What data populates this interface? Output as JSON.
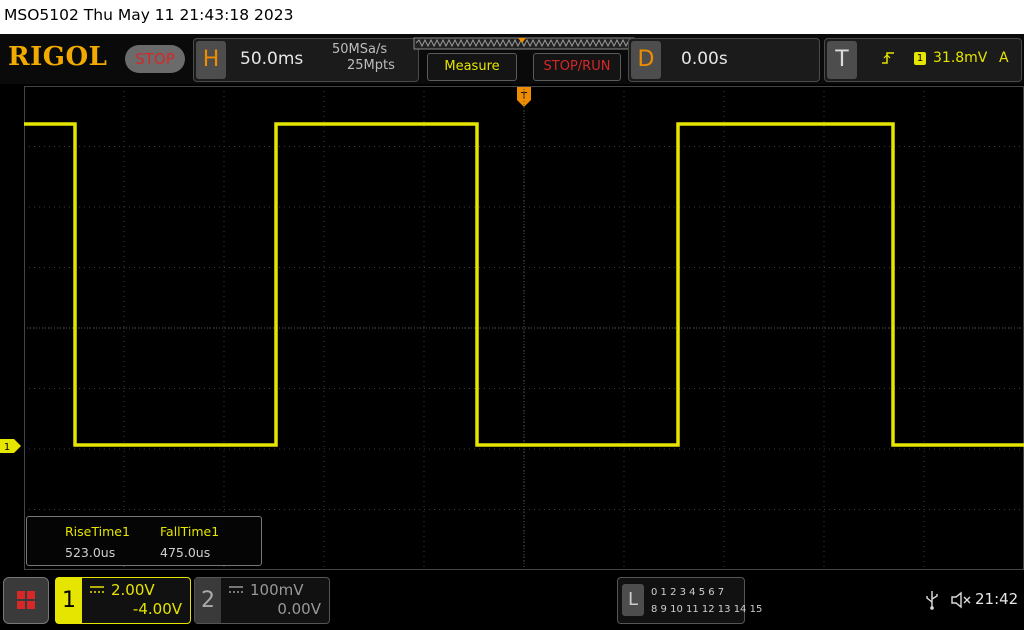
{
  "window": {
    "title": "MSO5102  Thu May 11 21:43:18 2023"
  },
  "header": {
    "logo": "RIGOL",
    "run_state": "STOP",
    "horizontal": {
      "letter": "H",
      "timebase": "50.0ms",
      "sample_rate": "50MSa/s",
      "memory_depth": "25Mpts"
    },
    "measure_label": "Measure",
    "stop_run_label": "STOP/RUN",
    "delay": {
      "letter": "D",
      "value": "0.00s"
    },
    "trigger": {
      "letter": "T",
      "source": "1",
      "level": "31.8mV",
      "mode": "A"
    }
  },
  "measurements": {
    "items": [
      {
        "label": "RiseTime1",
        "value": "523.0us"
      },
      {
        "label": "FallTime1",
        "value": "475.0us"
      }
    ]
  },
  "channels": [
    {
      "number": "1",
      "scale": "2.00V",
      "offset": "-4.00V",
      "active": true
    },
    {
      "number": "2",
      "scale": "100mV",
      "offset": "0.00V",
      "active": false
    }
  ],
  "ground_marker": "1",
  "la": {
    "letter": "L",
    "row1": "0 1 2 3   4 5 6 7",
    "row2": "8 9 10 11  12 13 14 15"
  },
  "status": {
    "clock": "21:42"
  },
  "colors": {
    "ch1": "#e5e500",
    "accent": "#f08c00",
    "stop": "#d62828",
    "grid": "#3c3c3c"
  },
  "icons": {
    "menu": "grid-menu-icon",
    "usb": "usb-icon",
    "sound": "speaker-muted-icon",
    "trigger_edge": "rising-edge-icon",
    "trigger_pos": "trigger-position-icon"
  }
}
